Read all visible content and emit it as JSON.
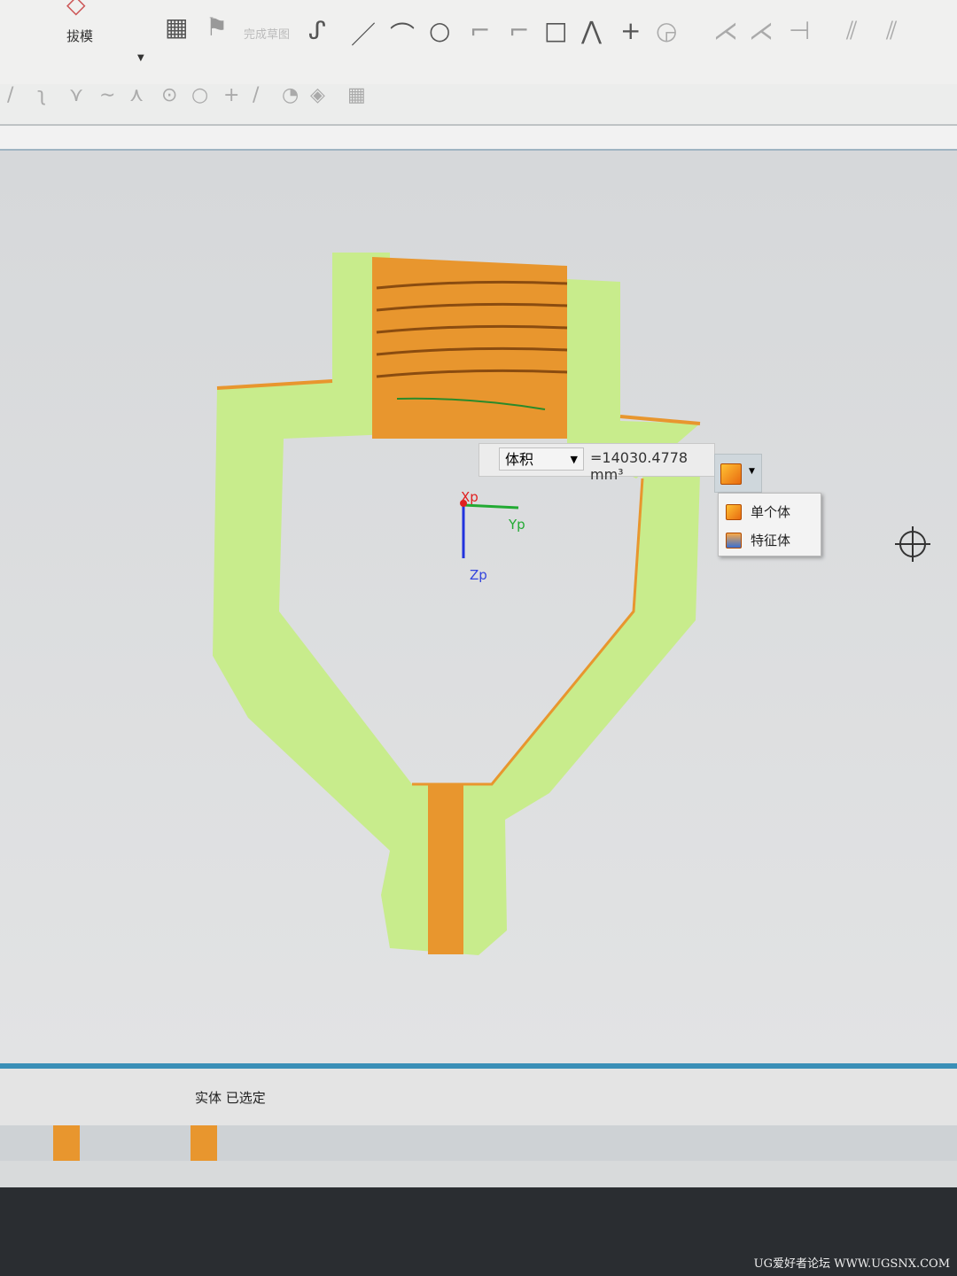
{
  "ribbon": {
    "draft_label": "拔模",
    "finish_sketch_label": "完成草图"
  },
  "icons": [
    "profile-icon",
    "line-icon",
    "arc-icon",
    "circle-icon",
    "fillet-icon",
    "chamfer-icon",
    "rectangle-icon",
    "polygon-icon",
    "point-icon",
    "offset-icon",
    "trim-icon",
    "extend-icon"
  ],
  "viewport": {
    "axis_x": "Xp",
    "axis_y": "Yp",
    "axis_z": "Zp"
  },
  "measure": {
    "type": "体积",
    "value": "=14030.4778 mm³"
  },
  "body_menu": {
    "items": [
      "单个体",
      "特征体"
    ]
  },
  "status": {
    "text": "实体 已选定"
  },
  "watermark": "UG爱好者论坛 WWW.UGSNX.COM",
  "colors": {
    "section": "#c8ec8c",
    "body": "#e8962e",
    "accent": "#3a8fb7"
  }
}
